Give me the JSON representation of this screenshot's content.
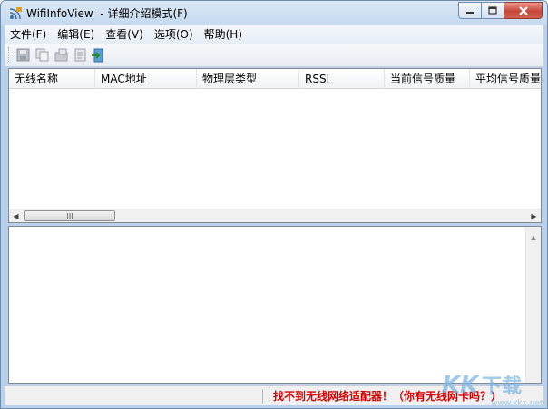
{
  "window": {
    "title": "WifiInfoView  - 详细介绍模式(F)"
  },
  "menu": [
    {
      "label": "文件(F)"
    },
    {
      "label": "编辑(E)"
    },
    {
      "label": "查看(V)"
    },
    {
      "label": "选项(O)"
    },
    {
      "label": "帮助(H)"
    }
  ],
  "toolbar": {
    "icons": [
      "save-icon",
      "copy-icon",
      "properties-icon",
      "report-icon",
      "exit-icon"
    ]
  },
  "table": {
    "columns": [
      "无线名称",
      "MAC地址",
      "物理层类型",
      "RSSI",
      "当前信号质量",
      "平均信号质量"
    ],
    "rows": []
  },
  "scrollbar": {
    "thumb_grip": "III"
  },
  "status": {
    "message": "找不到无线网络适配器！（你有无线网卡吗？）",
    "color": "#d40000"
  },
  "watermark": {
    "text": "KKX下载",
    "url": "www.kkx.net"
  },
  "colors": {
    "window_frame": "#b9d1ea",
    "close_button": "#c7463a"
  }
}
